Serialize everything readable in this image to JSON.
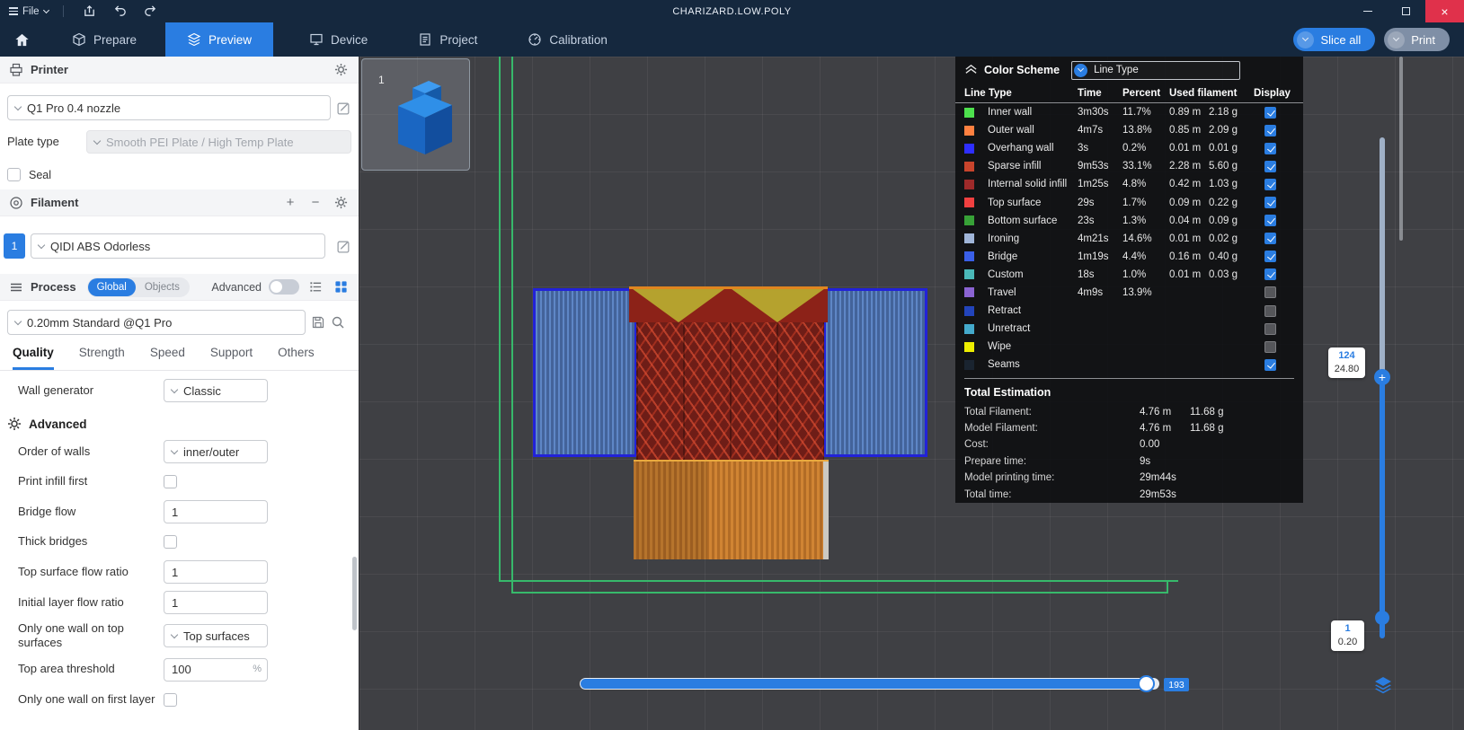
{
  "icons": {
    "plus": "+",
    "minus": "−",
    "close": "×"
  },
  "titlebar": {
    "menu_file": "File",
    "title": "CHARIZARD.LOW.POLY"
  },
  "navbar": {
    "tabs": [
      {
        "label": "Prepare"
      },
      {
        "label": "Preview"
      },
      {
        "label": "Device"
      },
      {
        "label": "Project"
      },
      {
        "label": "Calibration"
      }
    ],
    "slice_all": "Slice all",
    "print": "Print"
  },
  "printer": {
    "header": "Printer",
    "name": "Q1 Pro 0.4 nozzle",
    "plate_type_label": "Plate type",
    "plate_type_value": "Smooth PEI Plate / High Temp Plate",
    "seal_label": "Seal"
  },
  "filament": {
    "header": "Filament",
    "slot": "1",
    "name": "QIDI ABS Odorless"
  },
  "process": {
    "header": "Process",
    "scope_global": "Global",
    "scope_objects": "Objects",
    "advanced_label": "Advanced",
    "preset": "0.20mm Standard @Q1 Pro",
    "tabs": [
      "Quality",
      "Strength",
      "Speed",
      "Support",
      "Others"
    ]
  },
  "settings": {
    "advanced_header": "Advanced",
    "rows": [
      {
        "label": "Wall generator",
        "control": "select",
        "value": "Classic"
      },
      {
        "label": "Order of walls",
        "control": "select",
        "value": "inner/outer"
      },
      {
        "label": "Print infill first",
        "control": "checkbox",
        "checked": false
      },
      {
        "label": "Bridge flow",
        "control": "input",
        "value": "1"
      },
      {
        "label": "Thick bridges",
        "control": "checkbox",
        "checked": false
      },
      {
        "label": "Top surface flow ratio",
        "control": "input",
        "value": "1"
      },
      {
        "label": "Initial layer flow ratio",
        "control": "input",
        "value": "1"
      },
      {
        "label": "Only one wall on top surfaces",
        "control": "select",
        "value": "Top surfaces"
      },
      {
        "label": "Top area threshold",
        "control": "input",
        "value": "100",
        "suffix": "%"
      },
      {
        "label": "Only one wall on first layer",
        "control": "checkbox",
        "checked": false
      }
    ]
  },
  "plate": {
    "number": "1"
  },
  "legend": {
    "header": "Color Scheme",
    "scheme": "Line Type",
    "columns": {
      "type": "Line Type",
      "time": "Time",
      "percent": "Percent",
      "filament": "Used filament",
      "display": "Display"
    },
    "rows": [
      {
        "label": "Inner wall",
        "color": "#4DE04D",
        "time": "3m30s",
        "percent": "11.7%",
        "length": "0.89 m",
        "weight": "2.18 g",
        "display": true
      },
      {
        "label": "Outer wall",
        "color": "#FF8040",
        "time": "4m7s",
        "percent": "13.8%",
        "length": "0.85 m",
        "weight": "2.09 g",
        "display": true
      },
      {
        "label": "Overhang wall",
        "color": "#2E2EFF",
        "time": "3s",
        "percent": "0.2%",
        "length": "0.01 m",
        "weight": "0.01 g",
        "display": true
      },
      {
        "label": "Sparse infill",
        "color": "#C8442C",
        "time": "9m53s",
        "percent": "33.1%",
        "length": "2.28 m",
        "weight": "5.60 g",
        "display": true
      },
      {
        "label": "Internal solid infill",
        "color": "#9E2A2A",
        "time": "1m25s",
        "percent": "4.8%",
        "length": "0.42 m",
        "weight": "1.03 g",
        "display": true
      },
      {
        "label": "Top surface",
        "color": "#F04040",
        "time": "29s",
        "percent": "1.7%",
        "length": "0.09 m",
        "weight": "0.22 g",
        "display": true
      },
      {
        "label": "Bottom surface",
        "color": "#37A137",
        "time": "23s",
        "percent": "1.3%",
        "length": "0.04 m",
        "weight": "0.09 g",
        "display": true
      },
      {
        "label": "Ironing",
        "color": "#A0B5D8",
        "time": "4m21s",
        "percent": "14.6%",
        "length": "0.01 m",
        "weight": "0.02 g",
        "display": true
      },
      {
        "label": "Bridge",
        "color": "#3A5FE8",
        "time": "1m19s",
        "percent": "4.4%",
        "length": "0.16 m",
        "weight": "0.40 g",
        "display": true
      },
      {
        "label": "Custom",
        "color": "#4AB8B8",
        "time": "18s",
        "percent": "1.0%",
        "length": "0.01 m",
        "weight": "0.03 g",
        "display": true
      },
      {
        "label": "Travel",
        "color": "#8A63D2",
        "time": "4m9s",
        "percent": "13.9%",
        "length": "",
        "weight": "",
        "display": false
      },
      {
        "label": "Retract",
        "color": "#2244BB",
        "time": "",
        "percent": "",
        "length": "",
        "weight": "",
        "display": false
      },
      {
        "label": "Unretract",
        "color": "#44AACC",
        "time": "",
        "percent": "",
        "length": "",
        "weight": "",
        "display": false
      },
      {
        "label": "Wipe",
        "color": "#EDED00",
        "time": "",
        "percent": "",
        "length": "",
        "weight": "",
        "display": false
      },
      {
        "label": "Seams",
        "color": "#1A2430",
        "time": "",
        "percent": "",
        "length": "",
        "weight": "",
        "display": true
      }
    ],
    "total_header": "Total Estimation",
    "totals": [
      {
        "label": "Total Filament:",
        "a": "4.76 m",
        "b": "11.68 g"
      },
      {
        "label": "Model Filament:",
        "a": "4.76 m",
        "b": "11.68 g"
      },
      {
        "label": "Cost:",
        "a": "0.00",
        "b": ""
      },
      {
        "label": "Prepare time:",
        "a": "9s",
        "b": ""
      },
      {
        "label": "Model printing time:",
        "a": "29m44s",
        "b": ""
      },
      {
        "label": "Total time:",
        "a": "29m53s",
        "b": ""
      }
    ]
  },
  "sliders": {
    "layer_top": "124",
    "layer_top_z": "24.80",
    "layer_bottom": "1",
    "layer_bottom_z": "0.20",
    "h_value": "193"
  }
}
